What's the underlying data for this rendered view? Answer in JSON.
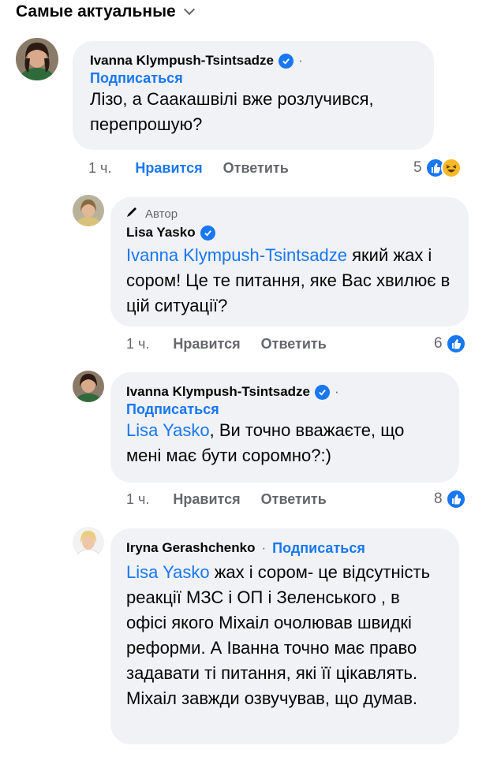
{
  "header": {
    "sort_label": "Самые актуальные"
  },
  "comments": [
    {
      "author": "Ivanna Klympush-Tsintsadze",
      "follow": "Подписаться",
      "dot": "·",
      "text": "Лізо, а Саакашвілі вже розлучився, перепрошую?",
      "time": "1 ч.",
      "like": "Нравится",
      "reply": "Ответить",
      "reaction_count": "5",
      "reactions": [
        "like-icon",
        "haha-icon"
      ]
    },
    {
      "author_tag": "Автор",
      "author": "Lisa Yasko",
      "mention": "Ivanna Klympush-Tsintsadze",
      "text": " який жах і сором! Це те питання, яке Вас хвилює в цій ситуації?",
      "time": "1 ч.",
      "like": "Нравится",
      "reply": "Ответить",
      "reaction_count": "6",
      "reactions": [
        "like-icon"
      ]
    },
    {
      "author": "Ivanna Klympush-Tsintsadze",
      "follow": "Подписаться",
      "dot": "·",
      "mention": "Lisa Yasko",
      "text": ", Ви точно вважаєте, що мені має бути соромно?:)",
      "time": "1 ч.",
      "like": "Нравится",
      "reply": "Ответить",
      "reaction_count": "8",
      "reactions": [
        "like-icon"
      ]
    },
    {
      "author": "Iryna Gerashchenko",
      "follow": "Подписаться",
      "dot": "·",
      "mention": "Lisa Yasko",
      "text": " жах і сором- це відсутність реакції МЗС і ОП і Зеленського , в офісі якого Міхаіл очолював швидкі реформи. А Іванна точно має право задавати ті питання, які її цікавлять. Міхаіл завжди озвучував, що думав."
    }
  ],
  "colors": {
    "accent": "#1877f2",
    "bubble": "#f0f2f5",
    "muted": "#65676b"
  }
}
